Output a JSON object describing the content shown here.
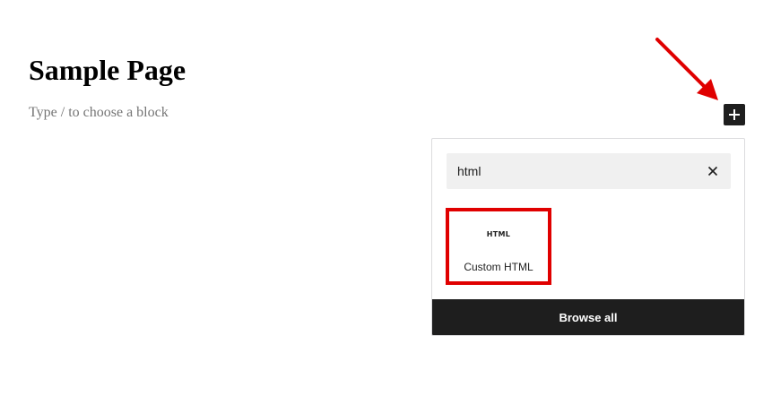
{
  "page": {
    "title": "Sample Page",
    "block_placeholder": "Type / to choose a block"
  },
  "toolbar": {
    "inserter_icon": "plus-icon"
  },
  "inserter": {
    "search": {
      "value": "html",
      "clear_icon": "close-icon"
    },
    "results": [
      {
        "icon_text": "HTML",
        "label": "Custom HTML",
        "highlighted": true
      }
    ],
    "browse_all_label": "Browse all"
  },
  "annotation": {
    "arrow_color": "#e00000",
    "highlight_color": "#e00000"
  },
  "colors": {
    "dark": "#1e1e1e",
    "search_bg": "#f0f0f0",
    "placeholder": "#757575"
  }
}
